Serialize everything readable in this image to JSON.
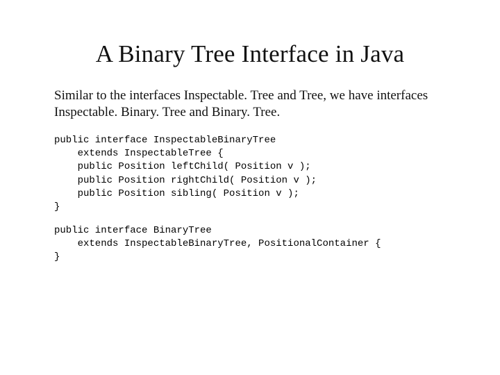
{
  "slide": {
    "title": "A Binary Tree Interface in Java",
    "prose": "Similar to the interfaces Inspectable. Tree and Tree, we have interfaces Inspectable. Binary. Tree and Binary. Tree.",
    "code1": "public interface InspectableBinaryTree\n    extends InspectableTree {\n    public Position leftChild( Position v );\n    public Position rightChild( Position v );\n    public Position sibling( Position v );\n}",
    "code2": "public interface BinaryTree\n    extends InspectableBinaryTree, PositionalContainer {\n}"
  }
}
